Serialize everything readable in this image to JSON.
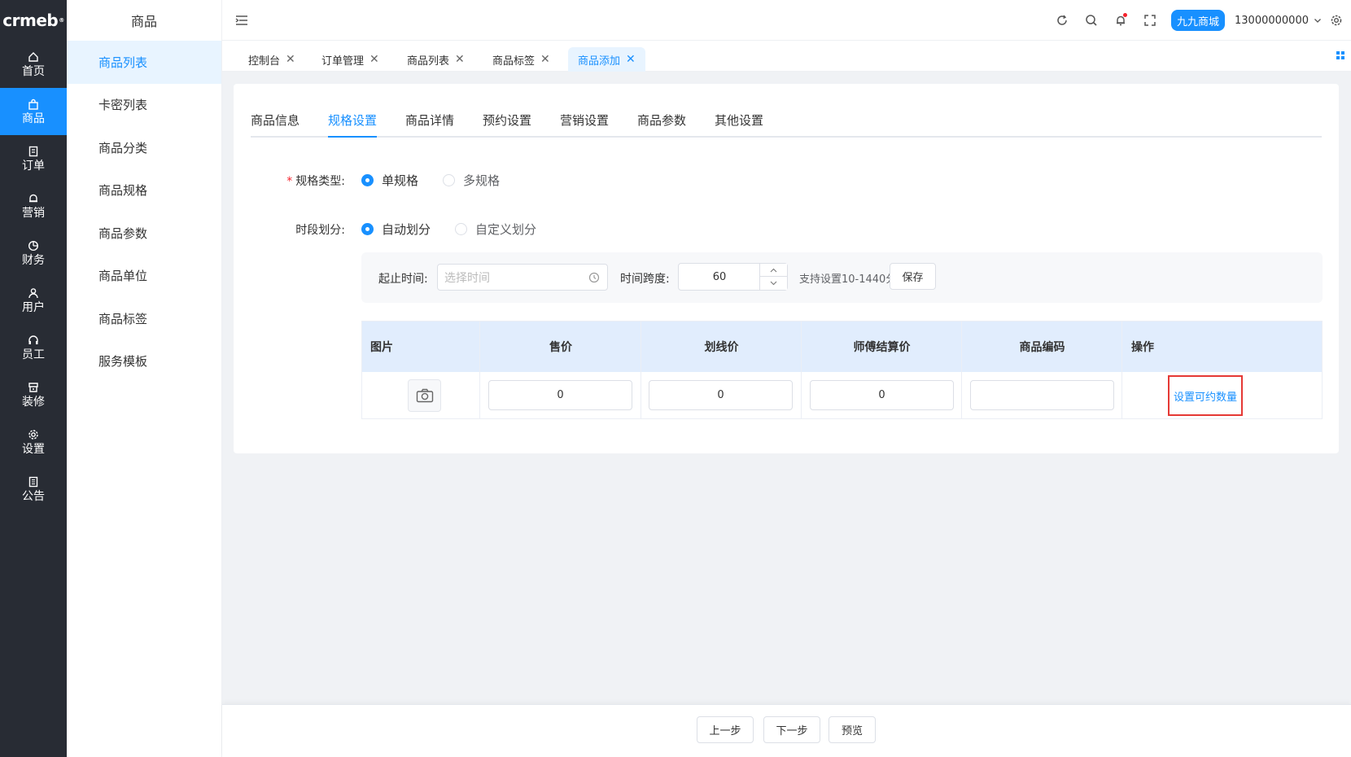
{
  "brand": {
    "logo_text": "crmeb",
    "logo_mark": "®"
  },
  "rail": {
    "items": [
      {
        "label": "首页",
        "icon": "home-icon"
      },
      {
        "label": "商品",
        "icon": "bag-icon"
      },
      {
        "label": "订单",
        "icon": "order-icon"
      },
      {
        "label": "营销",
        "icon": "bell-icon"
      },
      {
        "label": "财务",
        "icon": "pie-icon"
      },
      {
        "label": "用户",
        "icon": "user-icon"
      },
      {
        "label": "员工",
        "icon": "headset-icon"
      },
      {
        "label": "装修",
        "icon": "store-icon"
      },
      {
        "label": "设置",
        "icon": "gear-icon"
      },
      {
        "label": "公告",
        "icon": "notice-icon"
      }
    ],
    "active_index": 1,
    "colors": {
      "bg": "#282c34",
      "active": "#1890ff"
    }
  },
  "subnav": {
    "title": "商品",
    "items": [
      {
        "label": "商品列表"
      },
      {
        "label": "卡密列表"
      },
      {
        "label": "商品分类"
      },
      {
        "label": "商品规格"
      },
      {
        "label": "商品参数"
      },
      {
        "label": "商品单位"
      },
      {
        "label": "商品标签"
      },
      {
        "label": "服务模板"
      }
    ],
    "active_index": 0
  },
  "header": {
    "store_name": "九九商城",
    "user_name": "13000000000",
    "icons": [
      "refresh-icon",
      "search-icon",
      "bell-icon",
      "fullscreen-icon",
      "gear-icon"
    ],
    "notification_dot": true
  },
  "tabs": {
    "items": [
      {
        "label": "控制台"
      },
      {
        "label": "订单管理"
      },
      {
        "label": "商品列表"
      },
      {
        "label": "商品标签"
      },
      {
        "label": "商品添加"
      }
    ],
    "active_index": 4,
    "close_glyph": "✕"
  },
  "content_tabs": {
    "items": [
      {
        "label": "商品信息"
      },
      {
        "label": "规格设置"
      },
      {
        "label": "商品详情"
      },
      {
        "label": "预约设置"
      },
      {
        "label": "营销设置"
      },
      {
        "label": "商品参数"
      },
      {
        "label": "其他设置"
      }
    ],
    "active_index": 1
  },
  "form": {
    "spec_type": {
      "label": "规格类型:",
      "required_mark": "*",
      "options": [
        "单规格",
        "多规格"
      ],
      "selected": "单规格"
    },
    "time_division": {
      "label": "时段划分:",
      "options": [
        "自动划分",
        "自定义划分"
      ],
      "selected": "自动划分"
    },
    "time_config": {
      "start_end_label": "起止时间:",
      "start_end_placeholder": "选择时间",
      "span_label": "时间跨度:",
      "span_value": "60",
      "hint": "支持设置10-1440分钟",
      "save_label": "保存"
    }
  },
  "spec_table": {
    "columns": [
      "图片",
      "售价",
      "划线价",
      "师傅结算价",
      "商品编码",
      "操作"
    ],
    "rows": [
      {
        "price": "0",
        "original_price": "0",
        "settlement_price": "0",
        "code": "",
        "action": "设置可约数量"
      }
    ],
    "header_color": "#e1edfd",
    "highlight_color": "#e53935"
  },
  "footer": {
    "prev_label": "上一步",
    "next_label": "下一步",
    "preview_label": "预览"
  }
}
